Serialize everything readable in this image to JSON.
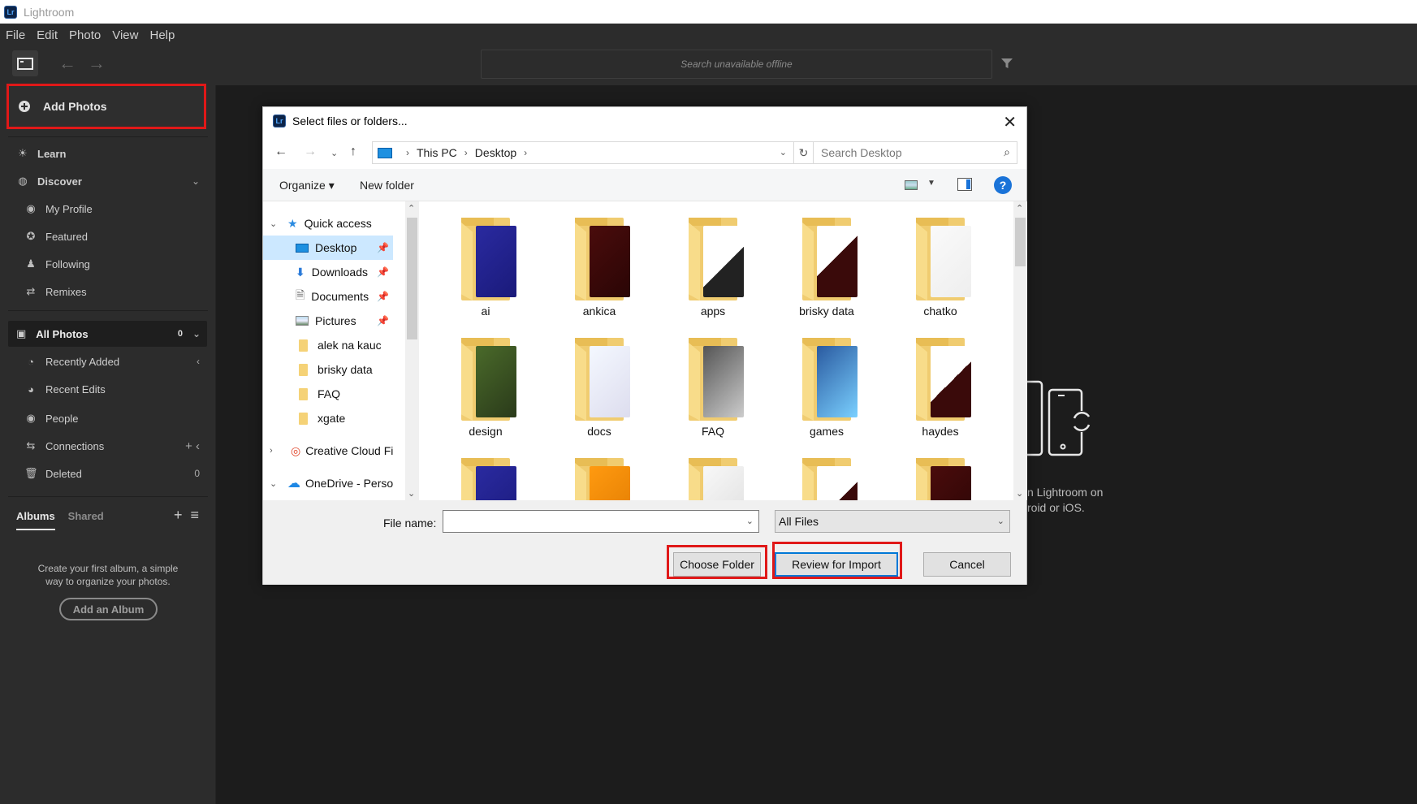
{
  "window": {
    "app_title": "Lightroom",
    "logo": "Lr"
  },
  "menu": [
    "File",
    "Edit",
    "Photo",
    "View",
    "Help"
  ],
  "toolbar": {
    "search_placeholder": "Search unavailable offline"
  },
  "sidebar": {
    "add_photos": "Add Photos",
    "learn": "Learn",
    "discover": "Discover",
    "discover_items": [
      "My Profile",
      "Featured",
      "Following",
      "Remixes"
    ],
    "all_photos": {
      "label": "All Photos",
      "count": "0"
    },
    "library_items": [
      {
        "label": "Recently Added",
        "right": "‹"
      },
      {
        "label": "Recent Edits",
        "right": ""
      },
      {
        "label": "People",
        "right": ""
      },
      {
        "label": "Connections",
        "right": "+  ‹"
      },
      {
        "label": "Deleted",
        "right": "0"
      }
    ],
    "albums_tab": "Albums",
    "shared_tab": "Shared",
    "album_hint_line1": "Create your first album, a simple",
    "album_hint_line2": "way to organize your photos.",
    "add_album": "Add an Album"
  },
  "main": {
    "hint_line1": "n Lightroom on",
    "hint_line2": "roid or iOS."
  },
  "dialog": {
    "title": "Select files or folders...",
    "logo": "Lr",
    "breadcrumb": [
      "This PC",
      "Desktop"
    ],
    "search_placeholder": "Search Desktop",
    "organize": "Organize ▾",
    "new_folder": "New folder",
    "help": "?",
    "nav_pane": {
      "quick_access": "Quick access",
      "pinned": [
        "Desktop",
        "Downloads",
        "Documents",
        "Pictures"
      ],
      "recent": [
        "alek na kauc",
        "brisky data",
        "FAQ",
        "xgate"
      ],
      "creative_cloud": "Creative Cloud Files",
      "onedrive": "OneDrive - Personal"
    },
    "folders": [
      "ai",
      "ankica",
      "apps",
      "brisky data",
      "chatko",
      "design",
      "docs",
      "FAQ",
      "games",
      "haydes"
    ],
    "file_name_label": "File name:",
    "file_name_value": "",
    "file_type": "All Files",
    "buttons": {
      "choose_folder": "Choose Folder",
      "review": "Review for Import",
      "cancel": "Cancel"
    }
  },
  "colors": {
    "highlight": "#e01818",
    "lr_blue": "#0d2447",
    "selection": "#cce8ff"
  }
}
